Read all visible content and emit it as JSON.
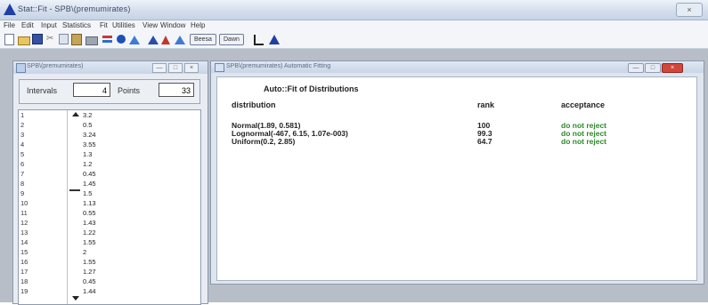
{
  "app": {
    "title": "Stat::Fit - SPB\\(premumirates)",
    "close_glyph": "×"
  },
  "menu": [
    "File",
    "Edit",
    "Input",
    "Statistics",
    "Fit",
    "Utilities",
    "View",
    "Window",
    "Help"
  ],
  "toolbar": {
    "cut_glyph": "✂",
    "buttons": [
      "Beesa",
      "Dawn"
    ]
  },
  "left_window": {
    "title": "SPB\\(premumirates)",
    "btn_min": "—",
    "btn_max": "□",
    "btn_close": "×",
    "intervals_label": "Intervals",
    "intervals_value": "4",
    "points_label": "Points",
    "points_value": "33",
    "rows": [
      {
        "idx": "1",
        "val": "3.2"
      },
      {
        "idx": "2",
        "val": "0.5"
      },
      {
        "idx": "3",
        "val": "3.24"
      },
      {
        "idx": "4",
        "val": "3.55"
      },
      {
        "idx": "5",
        "val": "1.3"
      },
      {
        "idx": "6",
        "val": "1.2"
      },
      {
        "idx": "7",
        "val": "0.45"
      },
      {
        "idx": "8",
        "val": "1.45"
      },
      {
        "idx": "9",
        "val": "1.5"
      },
      {
        "idx": "10",
        "val": "1.13"
      },
      {
        "idx": "11",
        "val": "0.55"
      },
      {
        "idx": "12",
        "val": "1.43"
      },
      {
        "idx": "13",
        "val": "1.22"
      },
      {
        "idx": "14",
        "val": "1.55"
      },
      {
        "idx": "15",
        "val": "2"
      },
      {
        "idx": "16",
        "val": "1.55"
      },
      {
        "idx": "17",
        "val": "1.27"
      },
      {
        "idx": "18",
        "val": "0.45"
      },
      {
        "idx": "19",
        "val": "1.44"
      }
    ]
  },
  "right_window": {
    "title": "SPB\\(premumirates) Automatic Fitting",
    "btn_min": "—",
    "btn_max": "□",
    "btn_close": "×",
    "heading": "Auto::Fit of Distributions",
    "columns": {
      "distribution": "distribution",
      "rank": "rank",
      "acceptance": "acceptance"
    },
    "rows": [
      {
        "distribution": "Normal(1.89, 0.581)",
        "rank": "100",
        "acceptance": "do not reject"
      },
      {
        "distribution": "Lognormal(-467, 6.15, 1.07e-003)",
        "rank": "99.3",
        "acceptance": "do not reject"
      },
      {
        "distribution": "Uniform(0.2, 2.85)",
        "rank": "64.7",
        "acceptance": "do not reject"
      }
    ]
  }
}
